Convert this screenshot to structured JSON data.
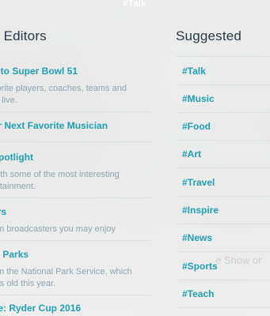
{
  "top_tag": "#Talk",
  "editors": {
    "title": "e Editors",
    "items": [
      {
        "title": "d to Super Bowl 51",
        "desc": "vorite players, coaches, teams and\nrs live."
      },
      {
        "title": "ur Next Favorite Musician",
        "desc": ""
      },
      {
        "title": "Spotlight",
        "desc": "with some of the most interesting\nertainment."
      },
      {
        "title": "ers",
        "desc": "om broadcasters you may enjoy"
      },
      {
        "title": "al Parks",
        "desc": "om the National Park Service, which\nars old this year."
      },
      {
        "title": "ne: Ryder Cup 2016",
        "desc": ""
      }
    ]
  },
  "suggested": {
    "title": "Suggested",
    "items": [
      "#Talk",
      "#Music",
      "#Food",
      "#Art",
      "#Travel",
      "#Inspire",
      "#News",
      "#Sports",
      "#Teach"
    ]
  },
  "ghost": {
    "show": "e Show or"
  }
}
